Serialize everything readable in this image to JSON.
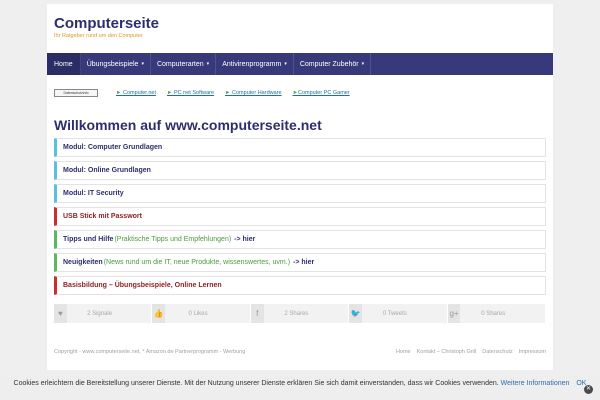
{
  "header": {
    "title": "Computerseite",
    "tagline": "Ihr Ratgeber rund um den Computer"
  },
  "nav": {
    "items": [
      {
        "label": "Home",
        "caret": false
      },
      {
        "label": "Übungsbeispiele",
        "caret": true
      },
      {
        "label": "Computerarten",
        "caret": true
      },
      {
        "label": "Antivirenprogramm",
        "caret": true
      },
      {
        "label": "Computer Zubehör",
        "caret": true
      }
    ],
    "caret_glyph": "▾"
  },
  "links": {
    "privacy_badge": "Datenschutzinfo",
    "items": [
      {
        "arrow": "►",
        "label": "Computer.net"
      },
      {
        "arrow": "►",
        "label": "PC net Software"
      },
      {
        "arrow": "►",
        "label": "Computer Hardware"
      },
      {
        "arrow": "►",
        "label": "Computer PC Gamer"
      }
    ]
  },
  "main": {
    "welcome": "Willkommen auf www.computerseite.net",
    "modules": [
      {
        "label": "Modul: Computer Grundlagen"
      },
      {
        "label": "Modul: Online Grundlagen"
      },
      {
        "label": "Modul: IT Security"
      },
      {
        "label": "USB Stick mit Passwort"
      },
      {
        "strong": "Tipps und Hilfe",
        "note": "(Praktische Tipps und Empfehlungen)",
        "suffix": "-> hier"
      },
      {
        "strong": "Neuigkeiten",
        "note": "(News rund um die IT, neue Produkte, wissenswertes, uvm.)",
        "suffix": "-> hier"
      },
      {
        "label": "Basisbildung – Übungsbeispiele, Online Lernen"
      }
    ]
  },
  "share": {
    "items": [
      {
        "icon": "heart-icon",
        "glyph": "♥",
        "count": "2 Signale"
      },
      {
        "icon": "thumbs-up-icon",
        "glyph": "👍",
        "count": "0 Likes"
      },
      {
        "icon": "facebook-icon",
        "glyph": "f",
        "count": "2 Shares"
      },
      {
        "icon": "twitter-icon",
        "glyph": "🐦",
        "count": "0 Tweets"
      },
      {
        "icon": "google-plus-icon",
        "glyph": "g+",
        "count": "0 Shares"
      }
    ]
  },
  "footer": {
    "copyright": "Copyright - www.computerseite.net, * Amazon.de Partnerprogramm - Werbung",
    "links": [
      "Home",
      "Kontakt – Christoph Grill",
      "Datenschutz",
      "Impressum"
    ]
  },
  "cookie": {
    "text": "Cookies erleichtern die Bereitstellung unserer Dienste. Mit der Nutzung unserer Dienste erklären Sie sich damit einverstanden, dass wir Cookies verwenden.",
    "more_label": "Weitere Informationen",
    "ok_label": "OK",
    "close_glyph": "✕"
  },
  "colors": {
    "brand": "#2d2e6f",
    "nav_bg": "#38397a",
    "accent_blue": "#5bc0de",
    "accent_red": "#c9302c",
    "accent_green": "#5cb85c"
  }
}
